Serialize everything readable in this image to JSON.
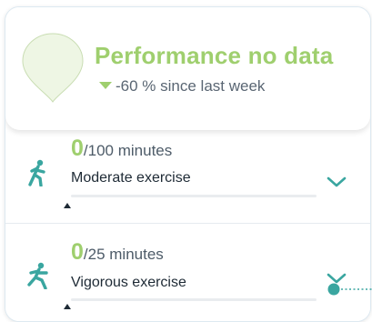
{
  "performance": {
    "title": "Performance no data",
    "trend_text": "-60 % since last week",
    "trend_direction": "down",
    "accent_color": "#9fcf6e",
    "indicator_color": "#eef6e4"
  },
  "activities": [
    {
      "value": "0",
      "total": "/100 minutes",
      "label": "Moderate exercise",
      "icon": "running-person-icon",
      "progress": 0
    },
    {
      "value": "0",
      "total": "/25 minutes",
      "label": "Vigorous exercise",
      "icon": "running-person-icon",
      "progress": 0
    }
  ],
  "colors": {
    "teal": "#3aa6a0",
    "track": "#e9ecef",
    "text_dark": "#1e2a35",
    "text_muted": "#5a6673"
  }
}
